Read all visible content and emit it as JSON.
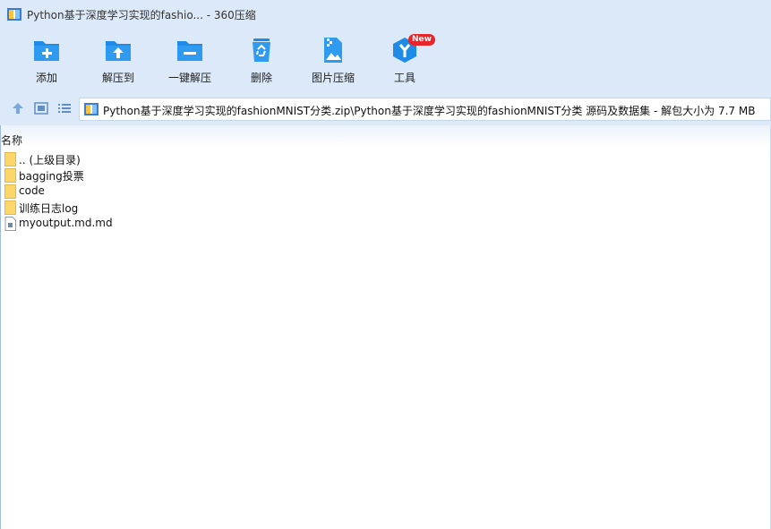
{
  "window": {
    "title": "Python基于深度学习实现的fashio... - 360压缩"
  },
  "toolbar": {
    "items": [
      {
        "label": "添加",
        "icon": "add-folder-icon"
      },
      {
        "label": "解压到",
        "icon": "extract-to-icon"
      },
      {
        "label": "一键解压",
        "icon": "one-click-extract-icon"
      },
      {
        "label": "删除",
        "icon": "recycle-bin-icon"
      },
      {
        "label": "图片压缩",
        "icon": "image-compress-icon"
      },
      {
        "label": "工具",
        "icon": "tools-cube-icon",
        "badge": "New"
      }
    ]
  },
  "nav": {
    "address": "Python基于深度学习实现的fashionMNIST分类.zip\\Python基于深度学习实现的fashionMNIST分类 源码及数据集 - 解包大小为 7.7 MB"
  },
  "list": {
    "column_name": "名称",
    "items": [
      {
        "name": ".. (上级目录)",
        "type": "folder"
      },
      {
        "name": "bagging投票",
        "type": "folder"
      },
      {
        "name": "code",
        "type": "folder"
      },
      {
        "name": "训练日志log",
        "type": "folder"
      },
      {
        "name": "myoutput.md.md",
        "type": "file"
      }
    ]
  },
  "colors": {
    "chrome_bg": "#dbe9f9",
    "icon_blue": "#1e8be6",
    "badge_red": "#e8262a",
    "folder_yellow": "#fbd66b"
  }
}
